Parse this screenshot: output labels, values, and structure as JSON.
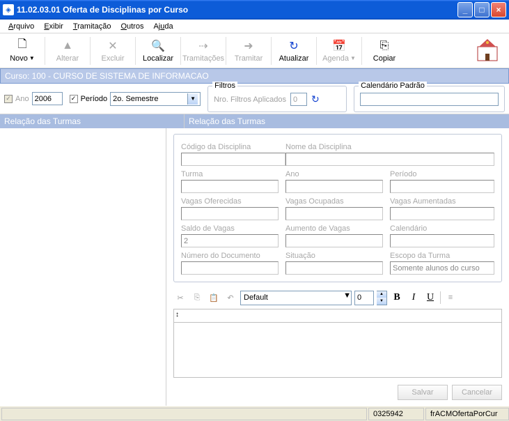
{
  "window": {
    "title": "11.02.03.01 Oferta de Disciplinas por Curso"
  },
  "menu": {
    "arquivo": "Arquivo",
    "exibir": "Exibir",
    "tramitacao": "Tramitação",
    "outros": "Outros",
    "ajuda": "Ajuda"
  },
  "toolbar": {
    "novo": "Novo",
    "alterar": "Alterar",
    "excluir": "Excluir",
    "localizar": "Localizar",
    "tramitacoes": "Tramitações",
    "tramitar": "Tramitar",
    "atualizar": "Atualizar",
    "agenda": "Agenda",
    "copiar": "Copiar"
  },
  "curso_bar": "Curso: 100 - CURSO DE SISTEMA DE INFORMACAO",
  "params": {
    "ano_label": "Ano",
    "ano_value": "2006",
    "periodo_label": "Período",
    "periodo_value": "2o. Semestre"
  },
  "filtros": {
    "legend": "Filtros",
    "label": "Nro. Filtros Aplicados",
    "value": "0"
  },
  "calendario": {
    "legend": "Calendário Padrão",
    "value": ""
  },
  "rel": {
    "left": "Relação das Turmas",
    "right": "Relação das Turmas"
  },
  "form": {
    "codigo_disc": {
      "label": "Código da Disciplina",
      "value": ""
    },
    "nome_disc": {
      "label": "Nome da Disciplina",
      "value": ""
    },
    "turma": {
      "label": "Turma",
      "value": ""
    },
    "ano": {
      "label": "Ano",
      "value": ""
    },
    "periodo": {
      "label": "Período",
      "value": ""
    },
    "vagas_of": {
      "label": "Vagas Oferecidas",
      "value": ""
    },
    "vagas_oc": {
      "label": "Vagas Ocupadas",
      "value": ""
    },
    "vagas_au": {
      "label": "Vagas Aumentadas",
      "value": ""
    },
    "saldo": {
      "label": "Saldo de Vagas",
      "value": "2"
    },
    "aumento": {
      "label": "Aumento de Vagas",
      "value": ""
    },
    "calendario": {
      "label": "Calendário",
      "value": ""
    },
    "num_doc": {
      "label": "Número do Documento",
      "value": ""
    },
    "situacao": {
      "label": "Situação",
      "value": ""
    },
    "escopo": {
      "label": "Escopo da Turma",
      "value": "Somente alunos do curso"
    }
  },
  "editor": {
    "font": "Default",
    "size": "0"
  },
  "buttons": {
    "salvar": "Salvar",
    "cancelar": "Cancelar"
  },
  "status": {
    "code": "0325942",
    "form": "frACMOfertaPorCur"
  }
}
